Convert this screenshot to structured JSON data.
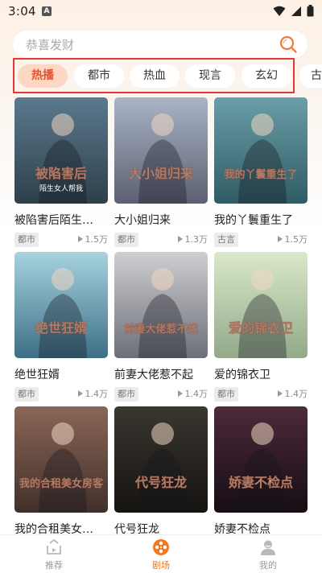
{
  "status_bar": {
    "time": "3:04",
    "notification": "A"
  },
  "search": {
    "placeholder": "恭喜发财"
  },
  "categories": [
    {
      "label": "热播",
      "active": true
    },
    {
      "label": "都市",
      "active": false
    },
    {
      "label": "热血",
      "active": false
    },
    {
      "label": "现言",
      "active": false
    },
    {
      "label": "玄幻",
      "active": false
    },
    {
      "label": "古",
      "active": false
    }
  ],
  "dramas": [
    {
      "title": "被陷害后陌生…",
      "tag": "都市",
      "views": "1.5万",
      "poster_text": "被陷害后",
      "poster_subtext": "陌生女人帮我 ",
      "poster_colors": [
        "#5a7a8e",
        "#2e3f4a"
      ]
    },
    {
      "title": "大小姐归来",
      "tag": "都市",
      "views": "1.3万",
      "poster_text": "大小姐归来",
      "poster_colors": [
        "#a9b4c6",
        "#5b6072"
      ]
    },
    {
      "title": "我的丫鬟重生了",
      "tag": "古言",
      "views": "1.5万",
      "poster_text": "我的丫鬟重生了",
      "poster_colors": [
        "#6b9ea7",
        "#2f5b64"
      ]
    },
    {
      "title": "绝世狂婿",
      "tag": "都市",
      "views": "1.4万",
      "poster_text": "绝世狂婿",
      "poster_colors": [
        "#a6d3df",
        "#3d6f86"
      ]
    },
    {
      "title": "前妻大佬惹不起",
      "tag": "都市",
      "views": "1.4万",
      "poster_text": "前妻大佬惹不起",
      "poster_colors": [
        "#cfcfd2",
        "#6b6f78"
      ]
    },
    {
      "title": "爱的锦衣卫",
      "tag": "都市",
      "views": "1.4万",
      "poster_text": "爱的锦衣卫",
      "poster_colors": [
        "#d9e9c9",
        "#93a98a"
      ]
    },
    {
      "title": "我的合租美女…",
      "tag": "",
      "views": "",
      "poster_text": "我的合租美女房客",
      "poster_colors": [
        "#8a6656",
        "#40302a"
      ]
    },
    {
      "title": "代号狂龙",
      "tag": "",
      "views": "",
      "poster_text": "代号狂龙",
      "poster_colors": [
        "#3a3630",
        "#151310"
      ]
    },
    {
      "title": "娇妻不检点",
      "tag": "",
      "views": "",
      "poster_text": "娇妻不检点",
      "poster_colors": [
        "#4c2a3a",
        "#160d13"
      ]
    }
  ],
  "bottom_nav": [
    {
      "label": "推荐",
      "icon": "recommend-icon",
      "active": false
    },
    {
      "label": "剧场",
      "icon": "theater-film-reel-icon",
      "active": true
    },
    {
      "label": "我的",
      "icon": "profile-icon",
      "active": false
    }
  ],
  "colors": {
    "accent": "#f2771e",
    "chip_active_bg": "#fcd7c4",
    "highlight_border": "#e23838"
  }
}
